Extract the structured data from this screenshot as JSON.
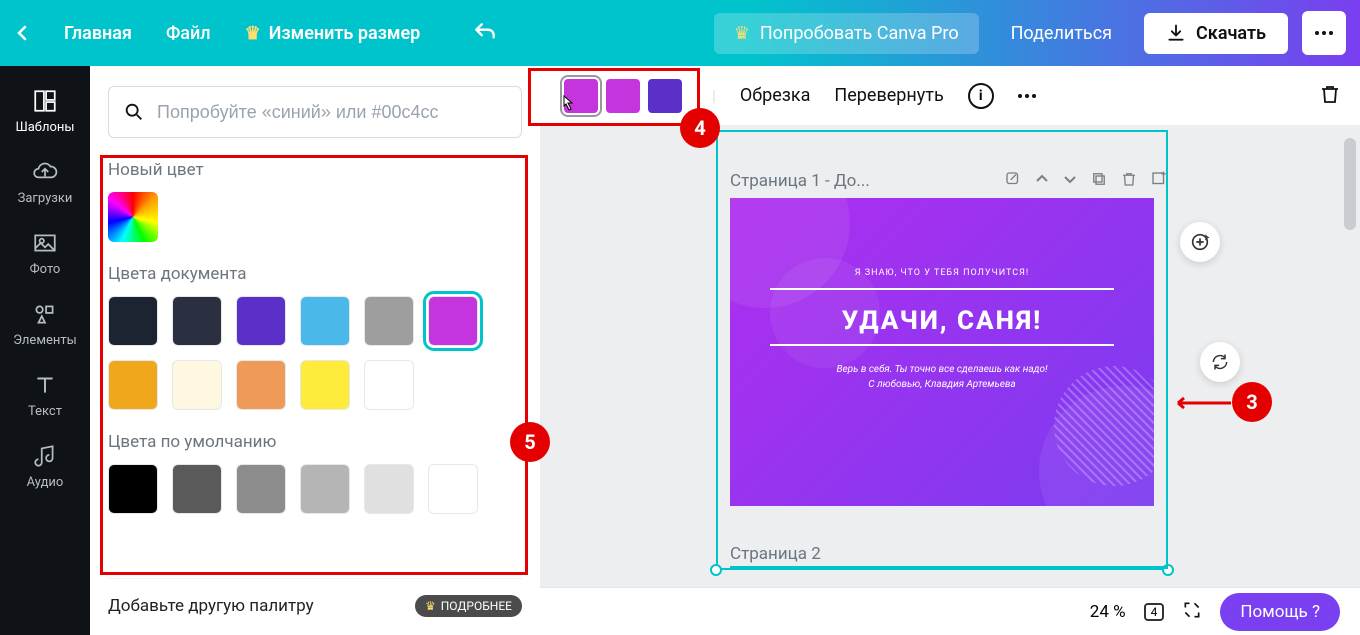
{
  "topbar": {
    "home": "Главная",
    "file": "Файл",
    "resize": "Изменить размер",
    "try_pro": "Попробовать Canva Pro",
    "share": "Поделиться",
    "download": "Скачать"
  },
  "rail": {
    "templates": "Шаблоны",
    "uploads": "Загрузки",
    "photos": "Фото",
    "elements": "Элементы",
    "text": "Текст",
    "audio": "Аудио"
  },
  "search": {
    "placeholder": "Попробуйте «синий» или #00c4cc"
  },
  "sections": {
    "new_color": "Новый цвет",
    "doc_colors": "Цвета документа",
    "default_colors": "Цвета по умолчанию",
    "add_palette": "Добавьте другую палитру",
    "more": "ПОДРОБНЕЕ"
  },
  "doc_colors_row1": [
    "#1b2430",
    "#2b3040",
    "#5a30c8",
    "#4ab8e8",
    "#9e9e9e",
    "#c535dd"
  ],
  "doc_colors_row2": [
    "#f0a71c",
    "#fff8e1",
    "#f09a5a",
    "#ffeb3b",
    "#ffffff"
  ],
  "default_colors": [
    "#000000",
    "#5a5a5a",
    "#8c8c8c",
    "#b5b5b5",
    "#e0e0e0",
    "#ffffff"
  ],
  "ctx": {
    "swatch1": "#c535dd",
    "swatch2": "#c535dd",
    "swatch3": "#5a30c8",
    "crop": "Обрезка",
    "flip": "Перевернуть"
  },
  "page1": {
    "label": "Страница 1 - До...",
    "top_text": "Я ЗНАЮ, ЧТО У ТЕБЯ ПОЛУЧИТСЯ!",
    "main_text": "УДАЧИ, САНЯ!",
    "sub1": "Верь в себя. Ты точно все сделаешь как надо!",
    "sub2": "С любовью, Клавдия Артемьева"
  },
  "page2": {
    "label": "Страница 2"
  },
  "bottom": {
    "zoom": "24 %",
    "pages": "4",
    "help": "Помощь  ?"
  },
  "markers": {
    "m3": "3",
    "m4": "4",
    "m5": "5"
  }
}
